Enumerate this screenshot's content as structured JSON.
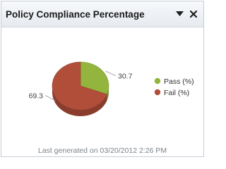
{
  "header": {
    "title": "Policy Compliance Percentage"
  },
  "chart_data": {
    "type": "pie",
    "labels": [
      "Pass (%)",
      "Fail (%)"
    ],
    "values": [
      30.7,
      69.3
    ],
    "value_labels": [
      "30.7",
      "69.3"
    ],
    "colors": [
      "#93b53d",
      "#b14e3a"
    ],
    "legend_position": "right",
    "title": ""
  },
  "legend": {
    "items": [
      {
        "label": "Pass (%)",
        "color": "#93b53d"
      },
      {
        "label": "Fail (%)",
        "color": "#b14e3a"
      }
    ]
  },
  "footer": {
    "text": "Last generated on 03/20/2012 2:26 PM"
  }
}
